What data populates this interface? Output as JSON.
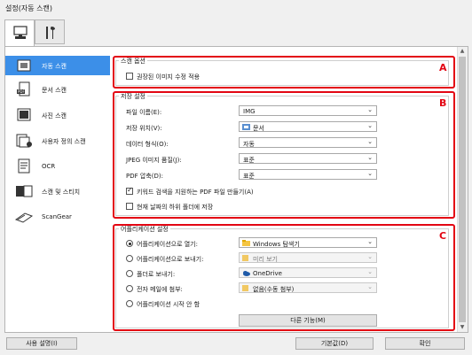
{
  "window": {
    "title": "설정(자동 스캔)"
  },
  "top_tabs": [
    {
      "name": "scan-tab",
      "icon": "computer-scan-icon"
    },
    {
      "name": "general-settings-tab",
      "icon": "tools-icon"
    }
  ],
  "sidebar": {
    "items": [
      {
        "label": "자동 스캔",
        "icon": "auto-scan-icon",
        "selected": true
      },
      {
        "label": "문서 스캔",
        "icon": "document-scan-icon"
      },
      {
        "label": "사진 스캔",
        "icon": "photo-scan-icon"
      },
      {
        "label": "사용자 정의 스캔",
        "icon": "custom-scan-icon"
      },
      {
        "label": "OCR",
        "icon": "ocr-icon"
      },
      {
        "label": "스캔 및 스티치",
        "icon": "scan-stitch-icon"
      },
      {
        "label": "ScanGear",
        "icon": "scangear-icon"
      }
    ]
  },
  "scan_options": {
    "title": "스캔 옵션",
    "apply_image_correction": {
      "label": "권장된 이미지 수정 적용",
      "checked": false
    },
    "marker": "A"
  },
  "save_settings": {
    "title": "저장 설정",
    "marker": "B",
    "file_name": {
      "label": "파일 이름(E):",
      "value": "IMG"
    },
    "save_in": {
      "label": "저장 위치(V):",
      "value": "문서"
    },
    "data_format": {
      "label": "데이터 형식(O):",
      "value": "자동"
    },
    "jpeg_quality": {
      "label": "JPEG 이미지 품질(J):",
      "value": "표준"
    },
    "pdf_compression": {
      "label": "PDF 압축(D):",
      "value": "표준"
    },
    "keyword_pdf": {
      "label": "키워드 검색을 지원하는 PDF 파일 만들기(A)",
      "checked": true
    },
    "subfolder_date": {
      "label": "현재 날짜의 하위 폴더에 저장",
      "checked": false
    }
  },
  "app_settings": {
    "title": "어플리케이션 설정",
    "marker": "C",
    "options": [
      {
        "label": "어플리케이션으로 열기:",
        "value": "Windows 탐색기",
        "checked": true,
        "enabled": true,
        "icon": "windows-explorer-icon"
      },
      {
        "label": "어플리케이션으로 보내기:",
        "value": "미리 보기",
        "checked": false,
        "enabled": false,
        "icon": "folder-icon"
      },
      {
        "label": "폴더로 보내기:",
        "value": "OneDrive",
        "checked": false,
        "enabled": false,
        "icon": "onedrive-icon"
      },
      {
        "label": "전자 메일에 첨부:",
        "value": "없음(수동 첨부)",
        "checked": false,
        "enabled": false,
        "icon": "folder-icon"
      },
      {
        "label": "어플리케이션 시작 안 함",
        "checked": false
      }
    ],
    "more_functions_label": "다른 기능(M)"
  },
  "footer": {
    "instructions_label": "사용 설명(I)",
    "defaults_label": "기본값(D)",
    "ok_label": "확인"
  },
  "colors": {
    "accent": "#3c8fe8",
    "marker_red": "#e30613"
  }
}
